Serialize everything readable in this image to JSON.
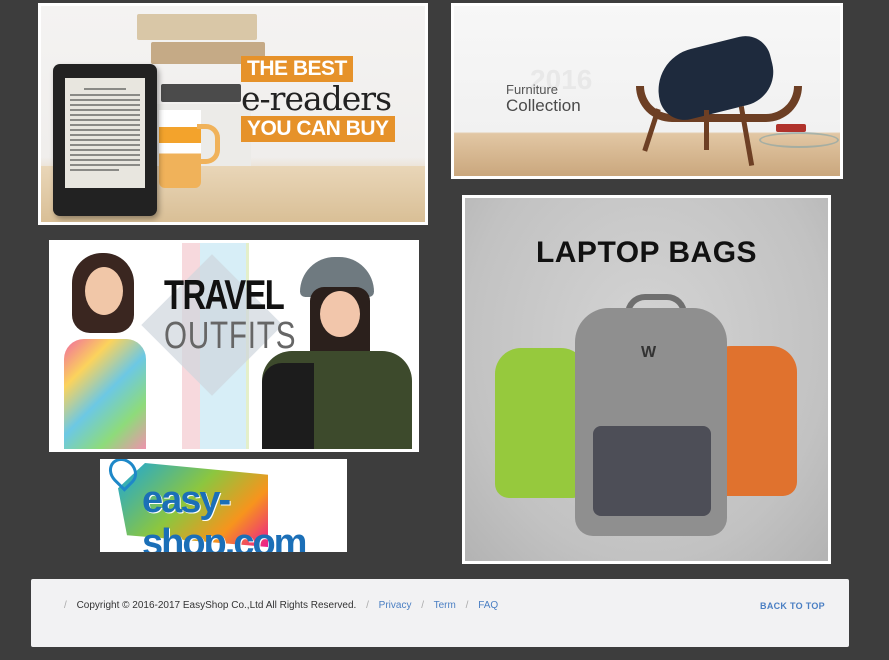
{
  "banners": {
    "ereaders": {
      "line1": "THE BEST",
      "line2": "e-readers",
      "line3": "YOU CAN BUY"
    },
    "furniture": {
      "year": "2016",
      "line1": "Furniture",
      "line2": "Collection"
    },
    "travel": {
      "line1": "TRAVEL",
      "line2": "OUTFITS"
    },
    "logo": {
      "text": "easy-shop.com"
    },
    "bags": {
      "title": "LAPTOP BAGS",
      "brand_mark": "W"
    }
  },
  "footer": {
    "copyright": "Copyright © 2016-2017 EasyShop Co.,Ltd All Rights Reserved.",
    "links": [
      "Privacy",
      "Term",
      "FAQ"
    ],
    "back_to_top": "BACK TO TOP"
  },
  "colors": {
    "page_bg": "#3d3d3d",
    "accent_orange": "#e6922a",
    "link_blue": "#4a7fc3",
    "footer_bg": "#f2f2f3"
  }
}
